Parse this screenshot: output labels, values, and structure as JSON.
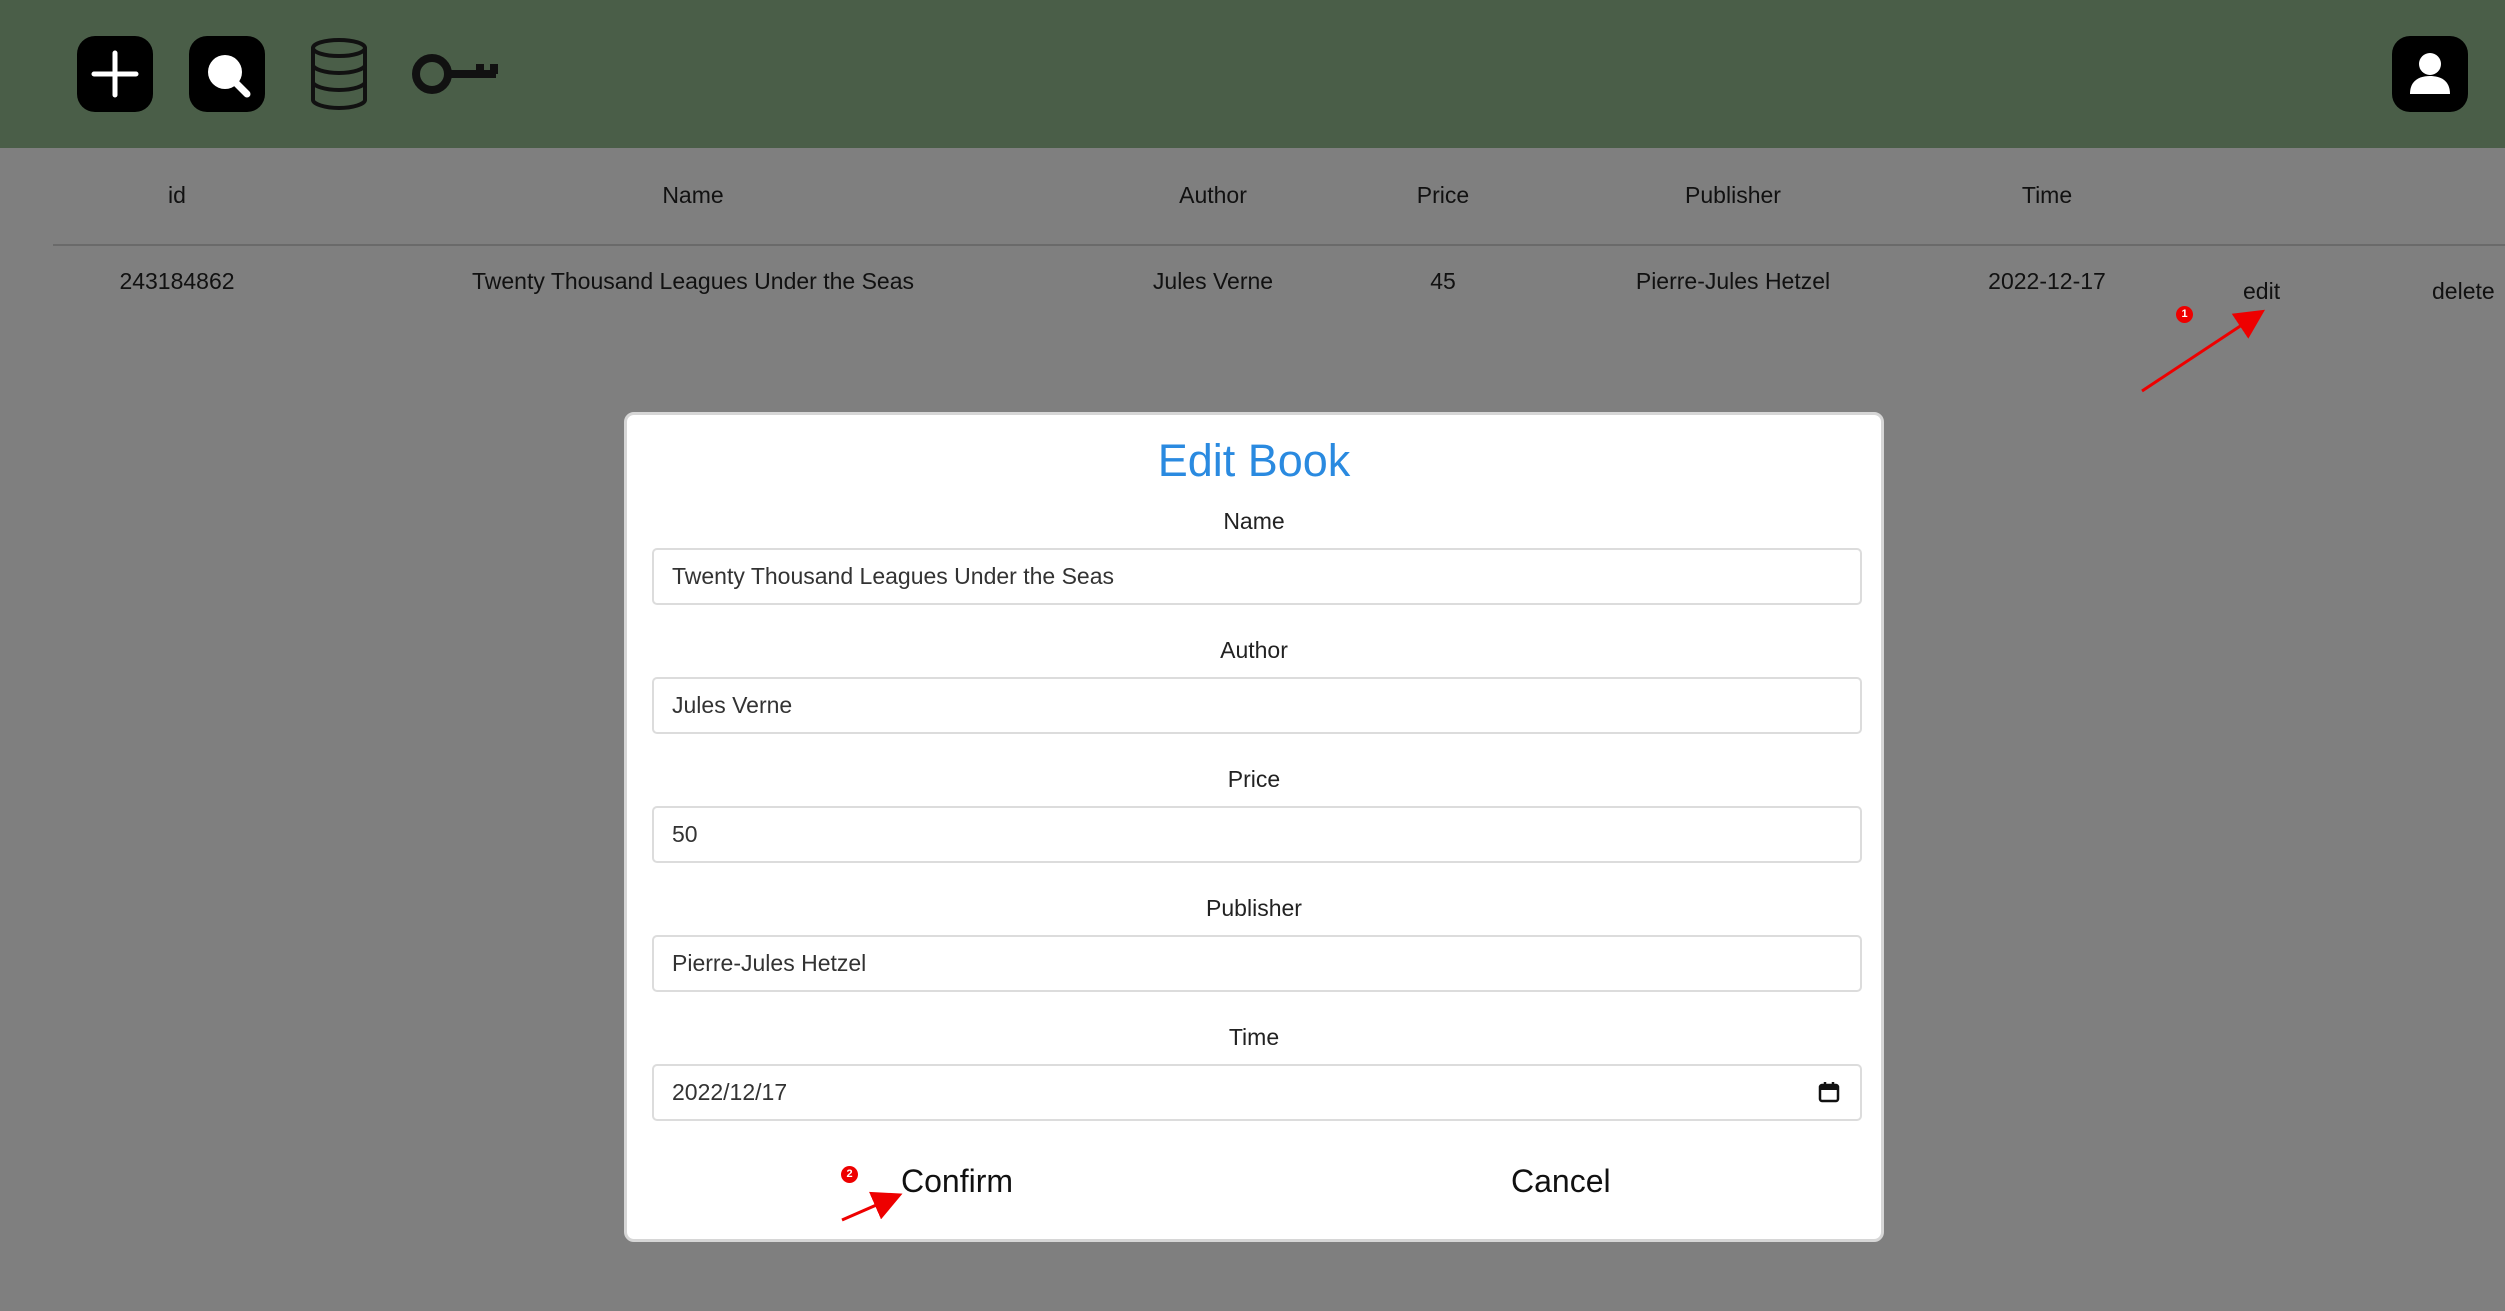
{
  "toolbar": {
    "icons": [
      "add-icon",
      "search-icon",
      "database-icon",
      "key-icon",
      "user-icon"
    ]
  },
  "table": {
    "headers": [
      "id",
      "Name",
      "Author",
      "Price",
      "Publisher",
      "Time"
    ],
    "rows": [
      {
        "id": "243184862",
        "name": "Twenty Thousand Leagues Under the Seas",
        "author": "Jules Verne",
        "price": "45",
        "publisher": "Pierre-Jules Hetzel",
        "time": "2022-12-17",
        "edit_label": "edit",
        "delete_label": "delete"
      }
    ]
  },
  "modal": {
    "title": "Edit Book",
    "fields": {
      "name": {
        "label": "Name",
        "value": "Twenty Thousand Leagues Under the Seas"
      },
      "author": {
        "label": "Author",
        "value": "Jules Verne"
      },
      "price": {
        "label": "Price",
        "value": "50"
      },
      "publisher": {
        "label": "Publisher",
        "value": "Pierre-Jules Hetzel"
      },
      "time": {
        "label": "Time",
        "value": "2022/12/17"
      }
    },
    "confirm_label": "Confirm",
    "cancel_label": "Cancel"
  },
  "annotations": {
    "step1": "1",
    "step2": "2",
    "color": "#ee0000"
  },
  "colors": {
    "topbar": "#4a5e48",
    "overlay": "#7f7f7f",
    "title": "#2a8ae0"
  }
}
